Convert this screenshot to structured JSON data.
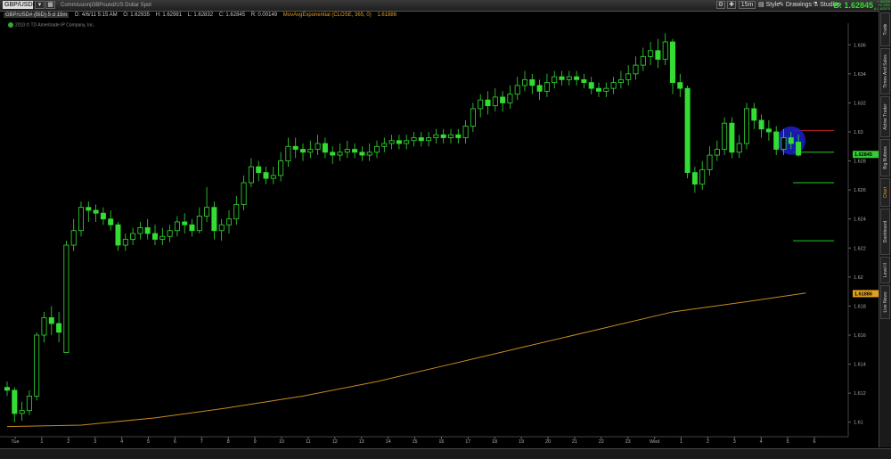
{
  "toolbar": {
    "symbol": "GBP/USD#",
    "description": "Commission|GBPound/US Dollar Spot",
    "timeframe": "15m",
    "style_label": "Style",
    "drawings_label": "Drawings",
    "studies_label": "Studies",
    "bid_label": "B: 1.62845",
    "mini_lines": [
      "+.00205",
      "+0.13%",
      "A:1.62875"
    ]
  },
  "info": {
    "symbol": "GBP/USD# (BID) 5 d 15m",
    "date": "D: 4/6/11 5:15 AM",
    "open": "O: 1.62935",
    "high": "H: 1.62981",
    "low": "L: 1.62832",
    "close": "C: 1.62845",
    "range": "R: 0.00149",
    "ma": "MovAvgExponential (CLOSE, 365, 0)",
    "ma_value": "1.61886"
  },
  "copyright": "2010 © TD Ameritrade IP Company, Inc.",
  "side_tabs": [
    "Trade",
    "Times And Sales",
    "Active Trader",
    "Big Buttons",
    "Chart",
    "Dashboard",
    "Level II",
    "Live News"
  ],
  "active_side_tab": "Chart",
  "colors": {
    "up": "#33dd33",
    "down": "#33dd33",
    "ma": "#c88a20",
    "price_tag": "#33cc33",
    "ma_tag": "#e0a020",
    "highlight": "#1a20c8",
    "red_line": "#cc2222"
  },
  "chart_data": {
    "type": "candlestick",
    "ylim": [
      1.609,
      1.637
    ],
    "y_ticks": [
      "1.636",
      "1.634",
      "1.632",
      "1.63",
      "1.628",
      "1.626",
      "1.624",
      "1.622",
      "1.62",
      "1.618",
      "1.616",
      "1.614",
      "1.612",
      "1.61",
      "1.608"
    ],
    "x_ticks": [
      "Tue",
      "1",
      "2",
      "3",
      "4",
      "5",
      "6",
      "7",
      "8",
      "9",
      "10",
      "11",
      "12",
      "13",
      "14",
      "15",
      "16",
      "17",
      "18",
      "19",
      "20",
      "21",
      "22",
      "23",
      "Wed",
      "1",
      "2",
      "3",
      "4",
      "5",
      "6"
    ],
    "price_labels": {
      "last": "1.62845",
      "ma": "1.61886"
    },
    "candles": [
      [
        1.6124,
        1.6122,
        1.6128,
        1.6118
      ],
      [
        1.6122,
        1.6106,
        1.6124,
        1.61
      ],
      [
        1.6106,
        1.6108,
        1.6114,
        1.6101
      ],
      [
        1.6108,
        1.6118,
        1.6122,
        1.6105
      ],
      [
        1.6118,
        1.616,
        1.6162,
        1.6115
      ],
      [
        1.616,
        1.6172,
        1.6176,
        1.6155
      ],
      [
        1.6172,
        1.6168,
        1.618,
        1.616
      ],
      [
        1.6168,
        1.6162,
        1.6176,
        1.6155
      ],
      [
        1.6148,
        1.6222,
        1.6225,
        1.6148
      ],
      [
        1.6222,
        1.6232,
        1.624,
        1.6218
      ],
      [
        1.6232,
        1.6248,
        1.6252,
        1.6228
      ],
      [
        1.6248,
        1.6246,
        1.6252,
        1.6238
      ],
      [
        1.6246,
        1.6244,
        1.625,
        1.6238
      ],
      [
        1.6244,
        1.624,
        1.6248,
        1.6236
      ],
      [
        1.624,
        1.6236,
        1.6246,
        1.6232
      ],
      [
        1.6236,
        1.6222,
        1.6238,
        1.6218
      ],
      [
        1.6222,
        1.6226,
        1.623,
        1.6218
      ],
      [
        1.6226,
        1.623,
        1.6234,
        1.6222
      ],
      [
        1.623,
        1.6234,
        1.6238,
        1.6226
      ],
      [
        1.6234,
        1.623,
        1.624,
        1.6226
      ],
      [
        1.623,
        1.6226,
        1.6236,
        1.6222
      ],
      [
        1.6226,
        1.6228,
        1.6234,
        1.6222
      ],
      [
        1.6228,
        1.6232,
        1.6236,
        1.6224
      ],
      [
        1.6232,
        1.6238,
        1.6242,
        1.6228
      ],
      [
        1.6238,
        1.6236,
        1.6244,
        1.623
      ],
      [
        1.6236,
        1.6232,
        1.624,
        1.6228
      ],
      [
        1.6232,
        1.6242,
        1.6248,
        1.623
      ],
      [
        1.6242,
        1.6248,
        1.6262,
        1.6238
      ],
      [
        1.6248,
        1.6232,
        1.6252,
        1.6226
      ],
      [
        1.6232,
        1.6236,
        1.624,
        1.6225
      ],
      [
        1.6236,
        1.624,
        1.6246,
        1.623
      ],
      [
        1.624,
        1.625,
        1.6256,
        1.6236
      ],
      [
        1.625,
        1.6265,
        1.627,
        1.6246
      ],
      [
        1.6265,
        1.6276,
        1.6282,
        1.6262
      ],
      [
        1.6276,
        1.6272,
        1.628,
        1.6266
      ],
      [
        1.6272,
        1.6268,
        1.6276,
        1.6264
      ],
      [
        1.6268,
        1.627,
        1.6276,
        1.6264
      ],
      [
        1.627,
        1.628,
        1.6286,
        1.6266
      ],
      [
        1.628,
        1.629,
        1.6296,
        1.6276
      ],
      [
        1.629,
        1.6288,
        1.6296,
        1.6282
      ],
      [
        1.6288,
        1.6286,
        1.6292,
        1.628
      ],
      [
        1.6286,
        1.6288,
        1.6294,
        1.6282
      ],
      [
        1.6288,
        1.6292,
        1.6298,
        1.6284
      ],
      [
        1.6292,
        1.6286,
        1.6296,
        1.6282
      ],
      [
        1.6286,
        1.6284,
        1.629,
        1.6278
      ],
      [
        1.6284,
        1.6286,
        1.6292,
        1.628
      ],
      [
        1.6286,
        1.6288,
        1.6294,
        1.6282
      ],
      [
        1.6288,
        1.6286,
        1.6292,
        1.6282
      ],
      [
        1.6286,
        1.6284,
        1.629,
        1.628
      ],
      [
        1.6284,
        1.6286,
        1.6292,
        1.628
      ],
      [
        1.6286,
        1.629,
        1.6294,
        1.6282
      ],
      [
        1.629,
        1.6292,
        1.6296,
        1.6286
      ],
      [
        1.6292,
        1.6294,
        1.6298,
        1.6288
      ],
      [
        1.6294,
        1.6292,
        1.6298,
        1.6288
      ],
      [
        1.6292,
        1.6294,
        1.6298,
        1.6288
      ],
      [
        1.6294,
        1.6296,
        1.63,
        1.629
      ],
      [
        1.6296,
        1.6294,
        1.63,
        1.629
      ],
      [
        1.6294,
        1.6296,
        1.63,
        1.629
      ],
      [
        1.6296,
        1.6298,
        1.6302,
        1.6292
      ],
      [
        1.6298,
        1.6296,
        1.6302,
        1.6292
      ],
      [
        1.6296,
        1.6298,
        1.6302,
        1.6292
      ],
      [
        1.6298,
        1.6296,
        1.6302,
        1.6292
      ],
      [
        1.6296,
        1.6304,
        1.6308,
        1.6292
      ],
      [
        1.6304,
        1.6316,
        1.632,
        1.63
      ],
      [
        1.6316,
        1.6322,
        1.6326,
        1.631
      ],
      [
        1.6322,
        1.6318,
        1.6328,
        1.6312
      ],
      [
        1.6318,
        1.6324,
        1.633,
        1.6314
      ],
      [
        1.6324,
        1.632,
        1.6328,
        1.6314
      ],
      [
        1.632,
        1.6326,
        1.6332,
        1.6316
      ],
      [
        1.6326,
        1.6332,
        1.6338,
        1.6322
      ],
      [
        1.6332,
        1.6336,
        1.6342,
        1.6328
      ],
      [
        1.6336,
        1.6332,
        1.634,
        1.6326
      ],
      [
        1.6332,
        1.6328,
        1.6336,
        1.6322
      ],
      [
        1.6328,
        1.6334,
        1.634,
        1.6324
      ],
      [
        1.6334,
        1.6338,
        1.6342,
        1.633
      ],
      [
        1.6338,
        1.6336,
        1.6342,
        1.6332
      ],
      [
        1.6336,
        1.6338,
        1.6342,
        1.6332
      ],
      [
        1.6338,
        1.6336,
        1.6342,
        1.6332
      ],
      [
        1.6336,
        1.6334,
        1.634,
        1.633
      ],
      [
        1.6334,
        1.633,
        1.6338,
        1.6326
      ],
      [
        1.633,
        1.6328,
        1.6334,
        1.6324
      ],
      [
        1.6328,
        1.633,
        1.6334,
        1.6324
      ],
      [
        1.633,
        1.6334,
        1.6338,
        1.6326
      ],
      [
        1.6334,
        1.6336,
        1.6342,
        1.633
      ],
      [
        1.6336,
        1.634,
        1.6346,
        1.6332
      ],
      [
        1.634,
        1.6346,
        1.6352,
        1.6336
      ],
      [
        1.6346,
        1.6352,
        1.6358,
        1.6342
      ],
      [
        1.6352,
        1.6356,
        1.6362,
        1.6346
      ],
      [
        1.6356,
        1.635,
        1.6364,
        1.6344
      ],
      [
        1.635,
        1.6362,
        1.6368,
        1.6346
      ],
      [
        1.6362,
        1.6334,
        1.6364,
        1.6326
      ],
      [
        1.6334,
        1.633,
        1.634,
        1.6324
      ],
      [
        1.633,
        1.6272,
        1.6332,
        1.6268
      ],
      [
        1.6272,
        1.6264,
        1.6276,
        1.6258
      ],
      [
        1.6264,
        1.6274,
        1.628,
        1.626
      ],
      [
        1.6274,
        1.6284,
        1.629,
        1.627
      ],
      [
        1.6284,
        1.6288,
        1.6294,
        1.628
      ],
      [
        1.6288,
        1.6306,
        1.631,
        1.6284
      ],
      [
        1.6306,
        1.6286,
        1.631,
        1.6282
      ],
      [
        1.6286,
        1.6292,
        1.6298,
        1.6282
      ],
      [
        1.6292,
        1.6316,
        1.632,
        1.6288
      ],
      [
        1.6316,
        1.6308,
        1.632,
        1.6302
      ],
      [
        1.6308,
        1.6302,
        1.6312,
        1.6296
      ],
      [
        1.6302,
        1.63,
        1.6308,
        1.6294
      ],
      [
        1.63,
        1.6288,
        1.6304,
        1.6284
      ],
      [
        1.6288,
        1.6296,
        1.6302,
        1.6284
      ],
      [
        1.6296,
        1.6292,
        1.63,
        1.6288
      ],
      [
        1.6293,
        1.6284,
        1.6298,
        1.6283
      ]
    ],
    "ma_series": {
      "name": "MovAvgExponential (CLOSE, 365, 0)",
      "points": [
        [
          0,
          1.6097
        ],
        [
          10,
          1.6098
        ],
        [
          20,
          1.6103
        ],
        [
          30,
          1.611
        ],
        [
          40,
          1.6118
        ],
        [
          50,
          1.6128
        ],
        [
          60,
          1.614
        ],
        [
          70,
          1.6152
        ],
        [
          80,
          1.6164
        ],
        [
          90,
          1.6176
        ],
        [
          100,
          1.6183
        ],
        [
          108,
          1.6189
        ]
      ]
    },
    "levels": [
      {
        "value": 1.6301,
        "color": "#cc2222"
      },
      {
        "value": 1.6286,
        "color": "#22cc22"
      },
      {
        "value": 1.6265,
        "color": "#22cc22"
      },
      {
        "value": 1.6225,
        "color": "#22cc22"
      }
    ]
  }
}
